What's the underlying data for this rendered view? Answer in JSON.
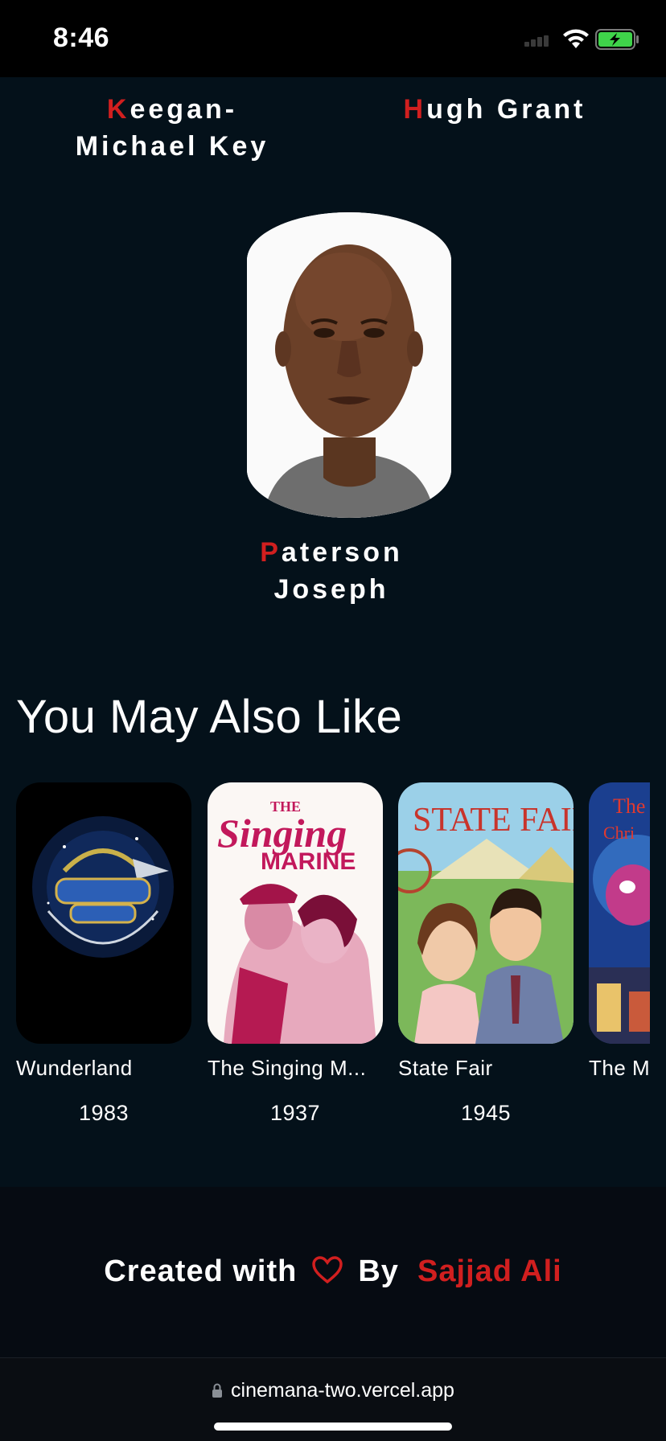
{
  "status_bar": {
    "time": "8:46"
  },
  "cast": [
    {
      "initial": "K",
      "rest": "eegan-Michael Key"
    },
    {
      "initial": "H",
      "rest": "ugh Grant"
    },
    {
      "initial": "P",
      "rest": "aterson Joseph"
    }
  ],
  "recommendations": {
    "title": "You May Also Like",
    "items": [
      {
        "title": "Wunderland",
        "year": "1983"
      },
      {
        "title": "The Singing M...",
        "year": "1937"
      },
      {
        "title": "State Fair",
        "year": "1945"
      },
      {
        "title": "The M",
        "year": ""
      }
    ]
  },
  "footer": {
    "created_with": "Created with",
    "by": "By",
    "author": "Sajjad Ali"
  },
  "browser": {
    "url": "cinemana-two.vercel.app"
  },
  "colors": {
    "accent": "#d11f1f",
    "background": "#04111a",
    "footer_bg": "#060b12"
  }
}
